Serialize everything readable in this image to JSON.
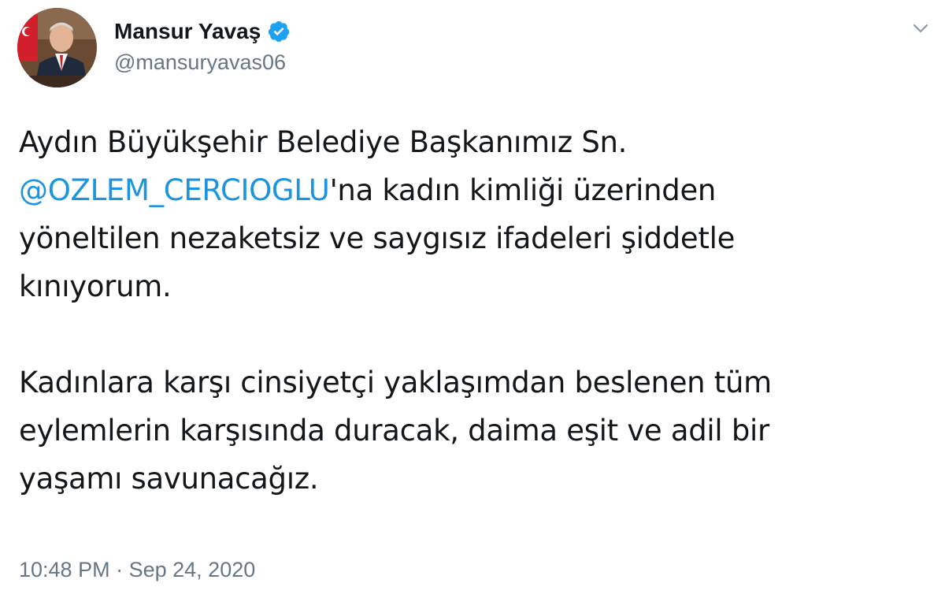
{
  "author": {
    "display_name": "Mansur Yavaş",
    "username": "@mansuryavas06",
    "verified": true
  },
  "tweet": {
    "line1": "Aydın Büyükşehir Belediye Başkanımız Sn.",
    "mention": "@OZLEM_CERCIOGLU",
    "line2_rest": "'na kadın kimliği üzerinden",
    "line3": "yöneltilen nezaketsiz ve saygısız ifadeleri şiddetle",
    "line4": "kınıyorum.",
    "para2_line1": "Kadınlara karşı cinsiyetçi yaklaşımdan beslenen tüm",
    "para2_line2": "eylemlerin karşısında duracak, daima eşit ve adil bir",
    "para2_line3": "yaşamı savunacağız."
  },
  "meta": {
    "time": "10:48 PM",
    "separator": "·",
    "date": "Sep 24, 2020"
  },
  "colors": {
    "link": "#1b95e0",
    "verified": "#1da1f2",
    "secondary_text": "#657786",
    "primary_text": "#14171a"
  },
  "icons": {
    "verified": "verified-badge-icon",
    "caret": "chevron-down-icon"
  }
}
